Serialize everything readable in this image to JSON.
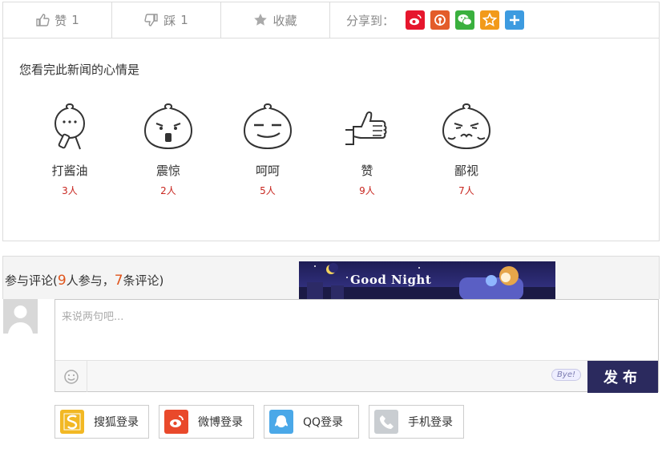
{
  "actions": {
    "like": {
      "label": "赞",
      "count": "1"
    },
    "dislike": {
      "label": "踩",
      "count": "1"
    },
    "favorite": {
      "label": "收藏"
    },
    "share_label": "分享到："
  },
  "share_targets": [
    {
      "name": "weibo",
      "color": "#e6162d"
    },
    {
      "name": "tencent-weibo",
      "color": "#e35d2a"
    },
    {
      "name": "wechat",
      "color": "#3ab03e"
    },
    {
      "name": "qzone",
      "color": "#f29a1a"
    },
    {
      "name": "more",
      "color": "#3d9be0"
    }
  ],
  "mood": {
    "title": "您看完此新闻的心情是",
    "items": [
      {
        "label": "打酱油",
        "count": "3人"
      },
      {
        "label": "震惊",
        "count": "2人"
      },
      {
        "label": "呵呵",
        "count": "5人"
      },
      {
        "label": "赞",
        "count": "9人"
      },
      {
        "label": "鄙视",
        "count": "7人"
      }
    ]
  },
  "comments": {
    "title_prefix": "参与评论(",
    "participants": "9",
    "participants_suffix": "人参与，",
    "comment_count": "7",
    "count_suffix": "条评论)",
    "banner_text": "Good Night",
    "placeholder": "来说两句吧...",
    "bye_text": "Bye!",
    "publish_label": "发布"
  },
  "logins": [
    {
      "label": "搜狐登录",
      "color": "#f2b824"
    },
    {
      "label": "微博登录",
      "color": "#e9492b"
    },
    {
      "label": "QQ登录",
      "color": "#4aa8e8"
    },
    {
      "label": "手机登录",
      "color": "#c9cdd1"
    }
  ]
}
